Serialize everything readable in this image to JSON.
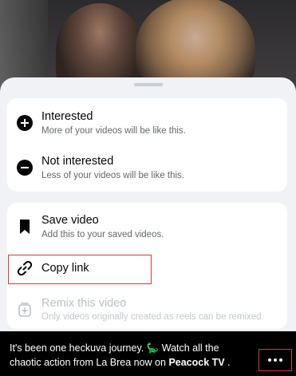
{
  "menu": {
    "interested": {
      "title": "Interested",
      "subtitle": "More of your videos will be like this."
    },
    "not_interested": {
      "title": "Not interested",
      "subtitle": "Less of your videos will be like this."
    },
    "save_video": {
      "title": "Save video",
      "subtitle": "Add this to your saved videos."
    },
    "copy_link": {
      "title": "Copy link"
    },
    "remix": {
      "title": "Remix this video",
      "subtitle": "Only videos originally created as reels can be remixed."
    }
  },
  "caption": {
    "text": "It's been one heckuva journey. 🦕 Watch all the chaotic action from La Brea now on",
    "brand": "Peacock TV",
    "end": "."
  },
  "colors": {
    "sheet_bg": "#f0f2f5",
    "highlight": "#d23b3b",
    "disabled": "#bcc0c4"
  }
}
